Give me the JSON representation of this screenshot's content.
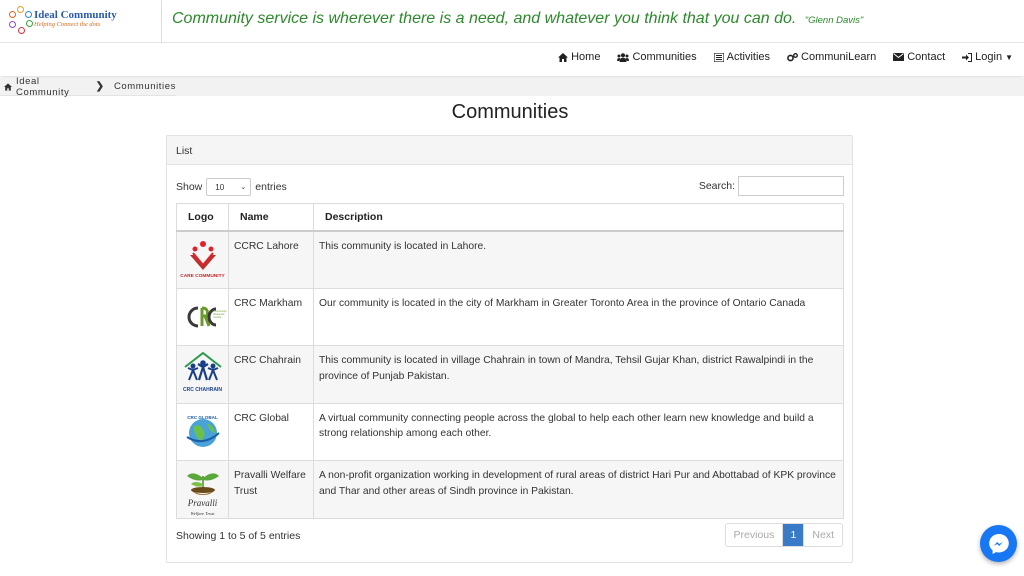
{
  "brand": {
    "name": "Ideal Community",
    "tagline": "Helping Connect the dots"
  },
  "quote": {
    "text": "Community service is wherever there is a need, and whatever you think that you can do.",
    "author": "\"Glenn Davis\""
  },
  "nav": {
    "items": [
      {
        "label": "Home",
        "icon": "home-icon"
      },
      {
        "label": "Communities",
        "icon": "users-icon"
      },
      {
        "label": "Activities",
        "icon": "list-icon"
      },
      {
        "label": "CommuniLearn",
        "icon": "gears-icon"
      },
      {
        "label": "Contact",
        "icon": "envelope-icon"
      },
      {
        "label": "Login",
        "icon": "sign-in-icon"
      }
    ]
  },
  "breadcrumb": {
    "home": "Ideal Community",
    "current": "Communities"
  },
  "page": {
    "title": "Communities",
    "panel_title": "List"
  },
  "controls": {
    "show_label": "Show",
    "entries_value": "10",
    "entries_label": "entries",
    "search_label": "Search:",
    "search_value": ""
  },
  "table": {
    "headers": [
      "Logo",
      "Name",
      "Description"
    ],
    "rows": [
      {
        "name": "CCRC Lahore",
        "logo_text": "CARE COMMUNITY",
        "description": "This community is located in Lahore."
      },
      {
        "name": "CRC Markham",
        "logo_text": "Community Resource Centre",
        "description": "Our community is located in the city of Markham in Greater Toronto Area in the province of Ontario Canada"
      },
      {
        "name": "CRC Chahrain",
        "logo_text": "CRC CHAHRAIN",
        "description": "This community is located in village Chahrain in town of Mandra, Tehsil Gujar Khan, district Rawalpindi in the province of Punjab Pakistan."
      },
      {
        "name": "CRC Global",
        "logo_text": "CRC GLOBAL",
        "description": "A virtual community connecting people across the global to help each other learn new knowledge and build a strong relationship among each other."
      },
      {
        "name": "Pravalli Welfare Trust",
        "logo_text": "Pravalli",
        "logo_sub": "Welfare Trust",
        "description": "A non-profit organization working in development of rural areas of district Hari Pur and Abottabad of KPK province and Thar and other areas of Sindh province in Pakistan."
      }
    ]
  },
  "footer": {
    "info": "Showing 1 to 5 of 5 entries",
    "previous": "Previous",
    "page": "1",
    "next": "Next"
  },
  "colors": {
    "quote": "#2c8a2c",
    "brand_blue": "#2a5caa",
    "pager_active": "#3a7bc8",
    "messenger": "#1877f2"
  }
}
